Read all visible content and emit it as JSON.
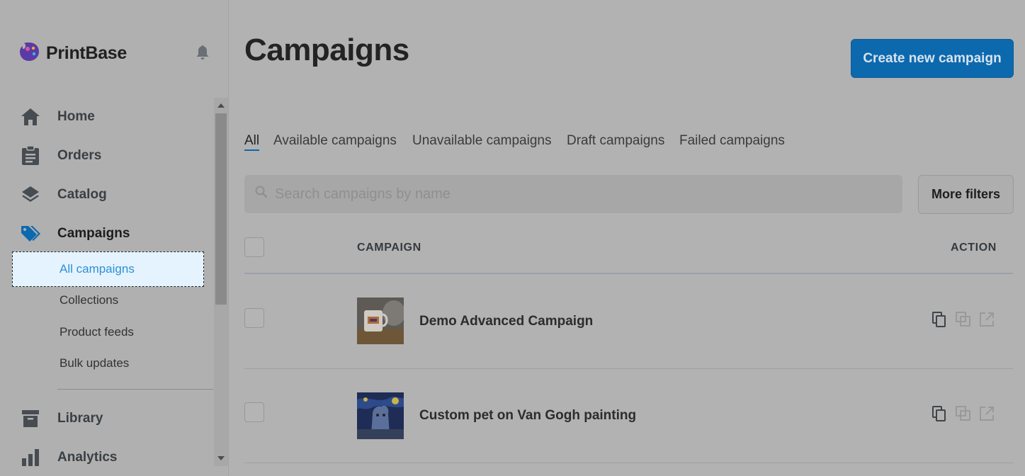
{
  "brand": {
    "name": "PrintBase"
  },
  "sidebar": {
    "items": [
      {
        "label": "Home",
        "icon": "home-icon"
      },
      {
        "label": "Orders",
        "icon": "clipboard-icon"
      },
      {
        "label": "Catalog",
        "icon": "layers-icon"
      },
      {
        "label": "Campaigns",
        "icon": "tags-icon",
        "active": true
      },
      {
        "label": "Library",
        "icon": "archive-icon"
      },
      {
        "label": "Analytics",
        "icon": "bar-chart-icon"
      }
    ],
    "sub_items": [
      {
        "label": "All campaigns",
        "active": true
      },
      {
        "label": "Collections"
      },
      {
        "label": "Product feeds"
      },
      {
        "label": "Bulk updates"
      }
    ]
  },
  "main": {
    "title": "Campaigns",
    "create_button": "Create new campaign",
    "tabs": [
      "All",
      "Available campaigns",
      "Unavailable campaigns",
      "Draft campaigns",
      "Failed campaigns"
    ],
    "search": {
      "placeholder": "Search campaigns by name"
    },
    "more_filters": "More filters",
    "table": {
      "columns": [
        "CAMPAIGN",
        "ACTION"
      ],
      "rows": [
        {
          "name": "Demo Advanced Campaign"
        },
        {
          "name": "Custom pet on Van Gogh painting"
        }
      ]
    }
  },
  "colors": {
    "accent": "#0c69ae",
    "active_sub_bg": "#e4f3fd",
    "active_sub_text": "#2f8fd6"
  }
}
